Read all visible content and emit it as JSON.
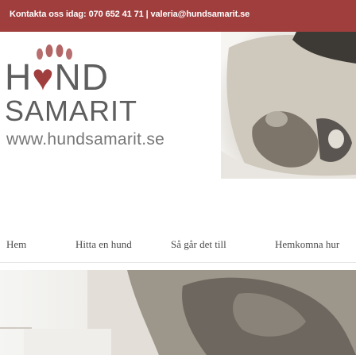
{
  "topbar": {
    "prefix": "Kontakta oss idag: ",
    "phone": "070 652 41 71",
    "separator": " | ",
    "email": "valeria@hundsamarit.se"
  },
  "logo": {
    "title_before": "H",
    "title_heart": "♥",
    "title_after": "ND",
    "subtitle": "SAMARIT",
    "url": "www.hundsamarit.se"
  },
  "nav": {
    "items": [
      {
        "label": "Hem"
      },
      {
        "label": "Hitta en hund"
      },
      {
        "label": "Så går det till"
      },
      {
        "label": "Hemkomna hur"
      }
    ]
  },
  "colors": {
    "brand": "#a03e3e",
    "logo_text": "#5e5e5e",
    "nav_text": "#4a4a4a"
  },
  "icons": [
    "paw-icon",
    "heart-icon"
  ]
}
